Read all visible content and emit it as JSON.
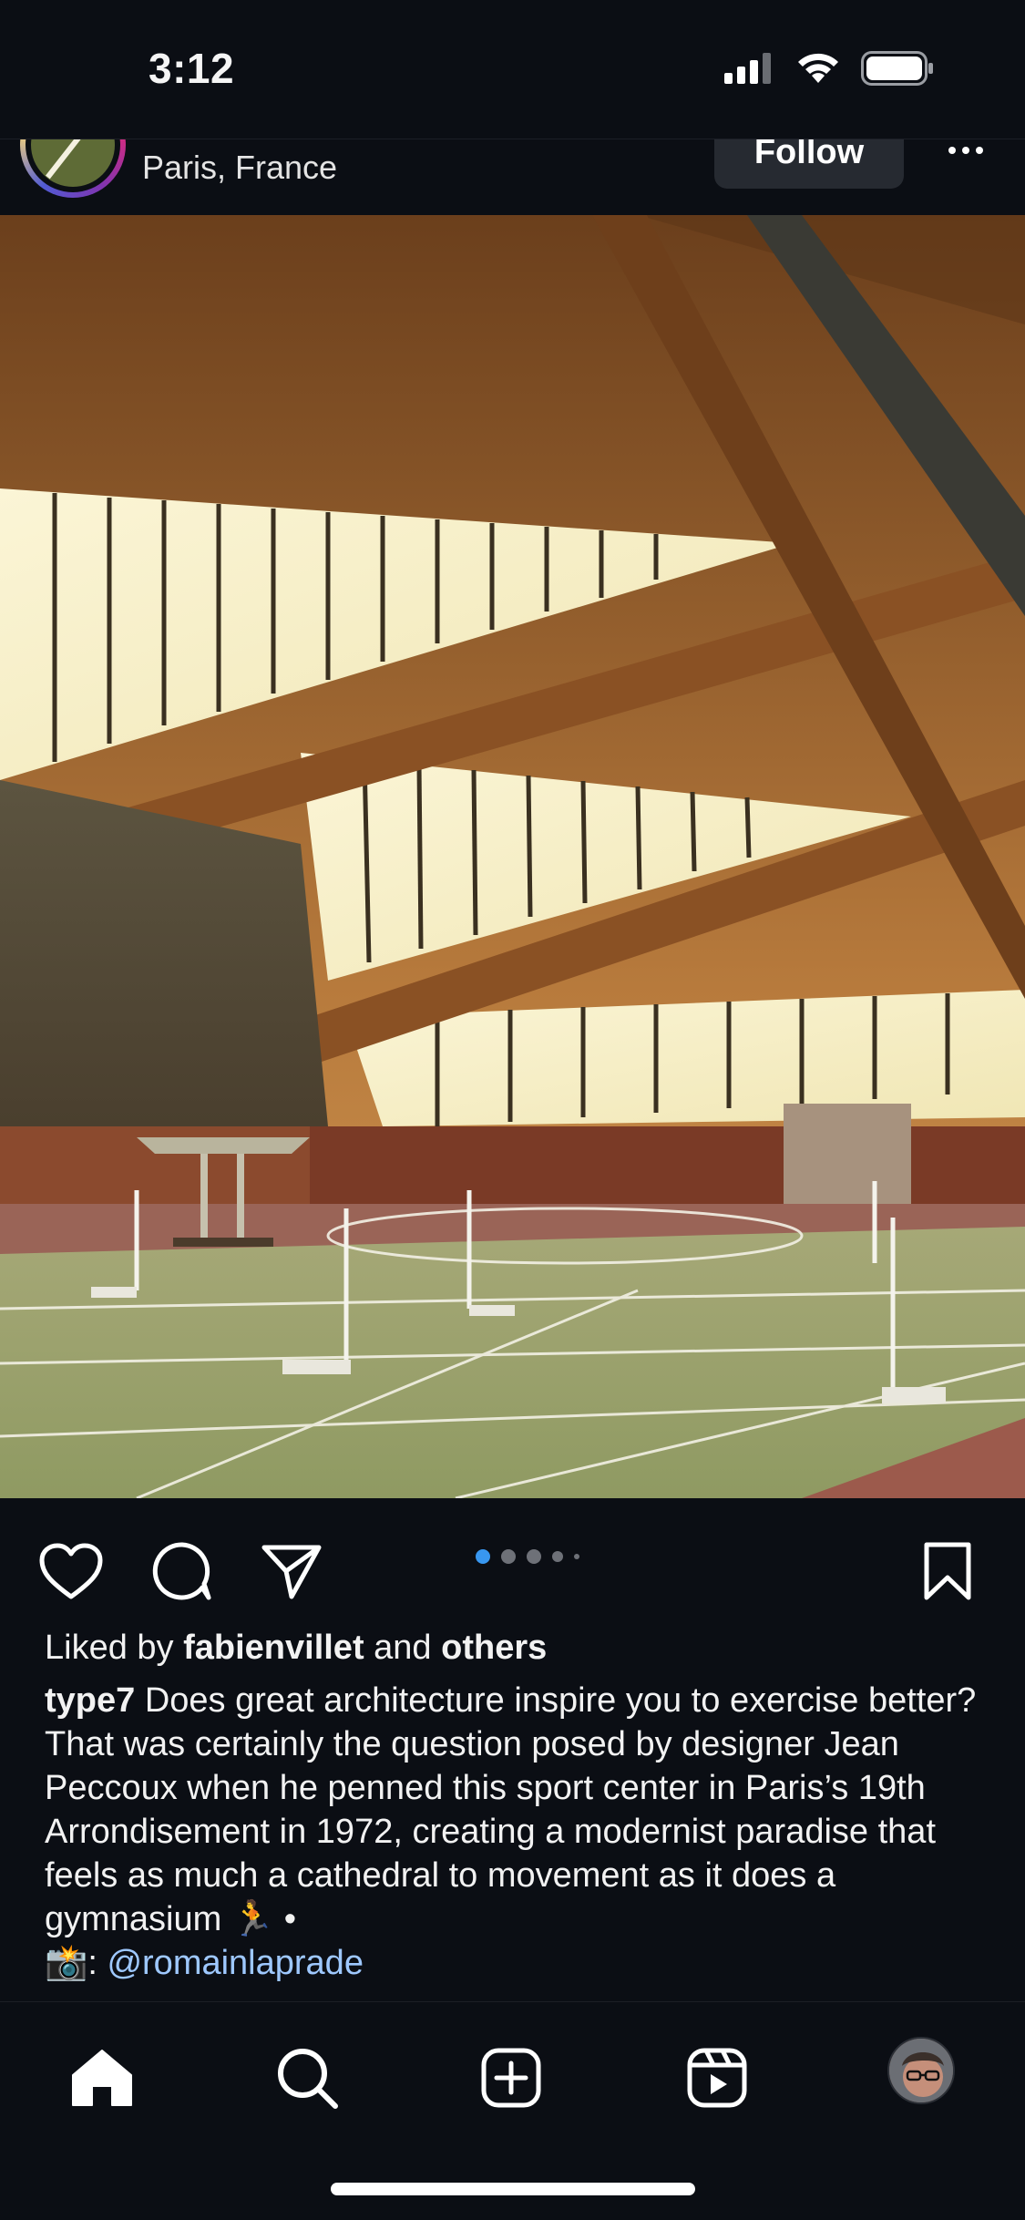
{
  "status_bar": {
    "time": "3:12",
    "icons": [
      "cellular-signal-icon",
      "wifi-icon",
      "battery-icon"
    ]
  },
  "post": {
    "location": "Paris, France",
    "follow_label": "Follow",
    "more_icon": "more-horizontal-icon",
    "image_alt_icon": "sports-hall-photo",
    "carousel": {
      "count": 5,
      "active_index": 0
    }
  },
  "actions": {
    "icons": [
      "heart-icon",
      "comment-icon",
      "share-icon",
      "bookmark-icon"
    ]
  },
  "likes": {
    "prefix": "Liked by ",
    "user": "fabienvillet",
    "middle": " and ",
    "others": "others"
  },
  "caption": {
    "username": "type7",
    "text": "Does great architecture inspire you to exercise better? That was certainly the question posed by designer Jean Peccoux when he penned this sport center in Paris’s 19th Arrondisement in 1972, creating a modernist paradise that feels as much a cathedral to movement as it does a gymnasium 🏃 •",
    "credit_emoji": "📸",
    "credit_sep": ": ",
    "credit_handle": "@romainlaprade"
  },
  "tab_bar": {
    "icons": [
      "home-icon",
      "search-icon",
      "create-post-icon",
      "reels-icon",
      "profile-avatar"
    ]
  },
  "colors": {
    "background": "#0b0e14",
    "carousel_active": "#3897f0",
    "mention": "#9ec8ff"
  }
}
